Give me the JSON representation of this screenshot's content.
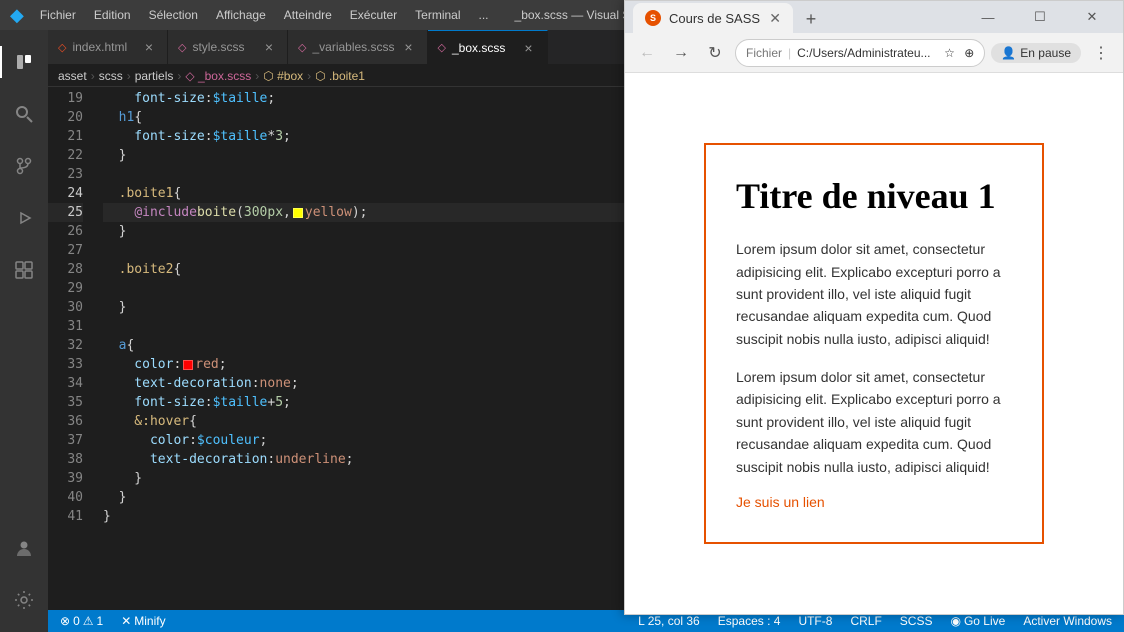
{
  "titlebar": {
    "vscode_icon": "◈",
    "menu_items": [
      "Fichier",
      "Edition",
      "Sélection",
      "Affichage",
      "Atteindre",
      "Exécuter",
      "Terminal",
      "..."
    ],
    "title": "_box.scss",
    "win_minimize": "—",
    "win_maximize": "☐",
    "win_close": "✕"
  },
  "tabs": [
    {
      "id": "index",
      "icon": "◇",
      "label": "index.html",
      "color": "#e44d26",
      "active": false
    },
    {
      "id": "style",
      "icon": "◇",
      "label": "style.scss",
      "color": "#cd6799",
      "active": false
    },
    {
      "id": "variables",
      "icon": "◇",
      "label": "_variables.scss",
      "color": "#cd6799",
      "active": false
    },
    {
      "id": "box",
      "icon": "◇",
      "label": "_box.scss",
      "color": "#cd6799",
      "active": true
    }
  ],
  "breadcrumb": [
    "asset",
    "scss",
    "partiels",
    "_box.scss",
    "#box",
    ".boite1"
  ],
  "lines": {
    "numbers": [
      19,
      20,
      21,
      22,
      23,
      24,
      25,
      26,
      27,
      28,
      29,
      30,
      31,
      32,
      33,
      34,
      35,
      36,
      37,
      38,
      39,
      40,
      41
    ],
    "active": 25
  },
  "statusbar": {
    "error_icon": "⊗",
    "errors": "0",
    "warn_icon": "⚠",
    "warnings": "1",
    "minify": "Minify",
    "position": "L 25, col 36",
    "spaces": "Espaces : 4",
    "encoding": "UTF-8",
    "line_ending": "CRLF",
    "language": "SCSS",
    "go_live": "◉ Go Live",
    "activate": "Activer Windows"
  },
  "chrome": {
    "tab_title": "Cours de SASS",
    "nav_back": "←",
    "nav_forward": "→",
    "nav_refresh": "↻",
    "address_scheme": "Fichier",
    "address_path": "C:/Users/Administrateu...",
    "star": "☆",
    "extensions": "⊕",
    "pause_label": "En pause",
    "more": "⋮",
    "new_tab": "+",
    "close_tab": "✕"
  },
  "preview": {
    "title": "Titre de niveau 1",
    "para1": "Lorem ipsum dolor sit amet, consectetur adipisicing elit. Explicabo excepturi porro a sunt provident illo, vel iste aliquid fugit recusandae aliquam expedita cum. Quod suscipit nobis nulla iusto, adipisci aliquid!",
    "para2": "Lorem ipsum dolor sit amet, consectetur adipisicing elit. Explicabo excepturi porro a sunt provident illo, vel iste aliquid fugit recusandae aliquam expedita cum. Quod suscipit nobis nulla iusto, adipisci aliquid!",
    "link": "Je suis un lien"
  }
}
